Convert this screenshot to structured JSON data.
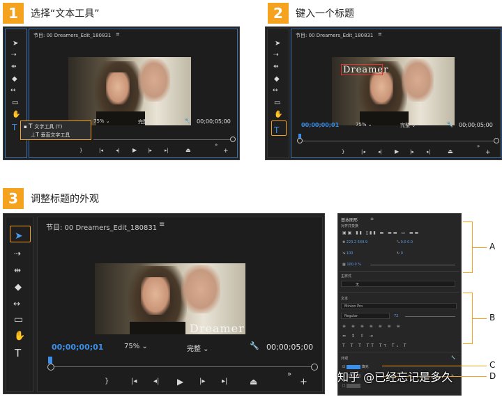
{
  "steps": [
    {
      "number": "1",
      "title": "选择“文本工具”"
    },
    {
      "number": "2",
      "title": "键入一个标题"
    },
    {
      "number": "3",
      "title": "调整标题的外观"
    }
  ],
  "monitor": {
    "title": "节目: 00 Dreamers_Edit_180831",
    "timecode_current": "00;00;00;01",
    "timecode_end": "00;00;05;00",
    "zoom": "75%",
    "quality": "完整"
  },
  "context_menu": {
    "items": [
      {
        "label": "文字工具 (T)",
        "selected": true
      },
      {
        "label": "垂直文字工具",
        "selected": false
      }
    ]
  },
  "title_text": "Dreamer",
  "essential_graphics": {
    "panel_title": "基本图形",
    "align_section": "对齐并变换",
    "master_style_label": "主样式",
    "master_style_value": "无",
    "text_section": "文本",
    "font": "Minion Pro",
    "font_style": "Regular",
    "font_size": "72",
    "appearance_section": "外观",
    "fill_label": "填充",
    "values": {
      "pos_x": "223.2",
      "pos_y": "549.9",
      "scale": "100",
      "rotation": "0",
      "opacity": "100.0 %",
      "anchor_x": "0.0",
      "anchor_y": "0.0"
    }
  },
  "callouts": [
    "A",
    "B",
    "C",
    "D"
  ],
  "watermark": "知乎 @已经忘记是多久",
  "colors": {
    "accent": "#f5a21e",
    "timecode": "#3b8fe8",
    "selection": "#3a6fb0"
  }
}
